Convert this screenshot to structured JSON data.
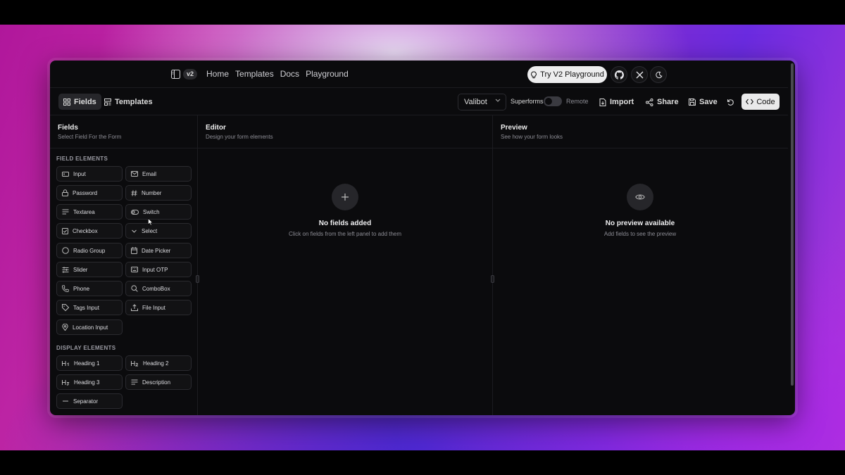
{
  "nav": {
    "version": "v2",
    "links": [
      "Home",
      "Templates",
      "Docs",
      "Playground"
    ],
    "try_label": "Try V2 Playground",
    "icons": [
      "github-icon",
      "x-icon",
      "moon-icon"
    ]
  },
  "toolbar": {
    "tabs": [
      "Fields",
      "Templates"
    ],
    "library_select": "Valibot",
    "toggle_left": "Superforms",
    "toggle_right": "Remote",
    "import_label": "Import",
    "share_label": "Share",
    "save_label": "Save",
    "code_label": "Code"
  },
  "fields_panel": {
    "title": "Fields",
    "subtitle": "Select Field For the Form",
    "field_section": "FIELD ELEMENTS",
    "field_elements": [
      "Input",
      "Email",
      "Password",
      "Number",
      "Textarea",
      "Switch",
      "Checkbox",
      "Select",
      "Radio Group",
      "Date Picker",
      "Slider",
      "Input OTP",
      "Phone",
      "ComboBox",
      "Tags Input",
      "File Input",
      "Location Input"
    ],
    "display_section": "DISPLAY ELEMENTS",
    "display_elements": [
      "Heading 1",
      "Heading 2",
      "Heading 3",
      "Description",
      "Separator"
    ]
  },
  "editor_panel": {
    "title": "Editor",
    "subtitle": "Design your form elements",
    "empty_title": "No fields added",
    "empty_sub": "Click on fields from the left panel to add them"
  },
  "preview_panel": {
    "title": "Preview",
    "subtitle": "See how your form looks",
    "empty_title": "No preview available",
    "empty_sub": "Add fields to see the preview"
  },
  "colors": {
    "background": "#0b0b0d",
    "border": "#1c1c20",
    "button_light": "#e9e9ea"
  }
}
